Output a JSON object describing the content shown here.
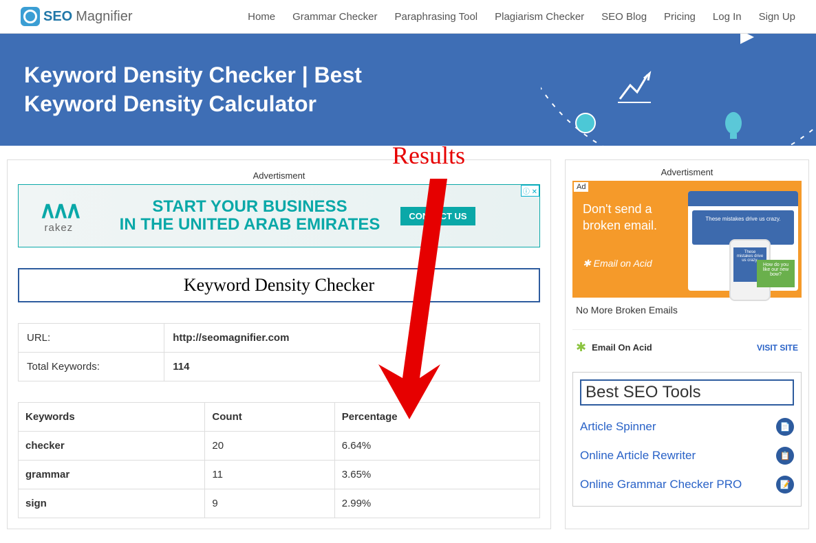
{
  "logo": {
    "part1": "SEO",
    "part2": "Magnifier"
  },
  "nav": [
    "Home",
    "Grammar Checker",
    "Paraphrasing Tool",
    "Plagiarism Checker",
    "SEO Blog",
    "Pricing",
    "Log In",
    "Sign Up"
  ],
  "hero": {
    "title": "Keyword Density Checker | Best Keyword Density Calculator"
  },
  "annotation": "Results",
  "ad_label": "Advertisment",
  "main_ad": {
    "brand": "rakez",
    "line1": "START YOUR BUSINESS",
    "line2": "IN THE UNITED ARAB EMIRATES",
    "cta": "CONTACT US"
  },
  "tool_title": "Keyword Density Checker",
  "info": {
    "url_label": "URL:",
    "url_value": "http://seomagnifier.com",
    "total_label": "Total Keywords:",
    "total_value": "114"
  },
  "table": {
    "headers": [
      "Keywords",
      "Count",
      "Percentage"
    ],
    "rows": [
      {
        "keyword": "checker",
        "count": "20",
        "percentage": "6.64%"
      },
      {
        "keyword": "grammar",
        "count": "11",
        "percentage": "3.65%"
      },
      {
        "keyword": "sign",
        "count": "9",
        "percentage": "2.99%"
      }
    ]
  },
  "sidebar_ad": {
    "tag": "Ad",
    "headline1": "Don't send a",
    "headline2": "broken email.",
    "logo_text": "Email on Acid",
    "mockup_text": "These mistakes drive us crazy.",
    "green_text": "How do you like our new bow?",
    "footer": "No More Broken Emails",
    "brand": "Email On Acid",
    "visit": "VISIT SITE"
  },
  "tools_box": {
    "title": "Best SEO Tools",
    "links": [
      "Article Spinner",
      "Online Article Rewriter",
      "Online Grammar Checker PRO"
    ]
  }
}
